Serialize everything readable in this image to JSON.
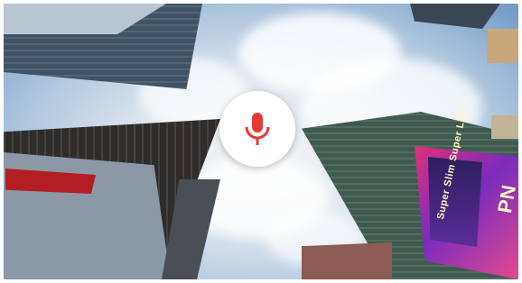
{
  "scene": {
    "billboard_text": "Super Slim Super LED",
    "sign_letters": "PN"
  },
  "voice_search": {
    "icon": "microphone-icon",
    "accent_color": "#e53935"
  }
}
